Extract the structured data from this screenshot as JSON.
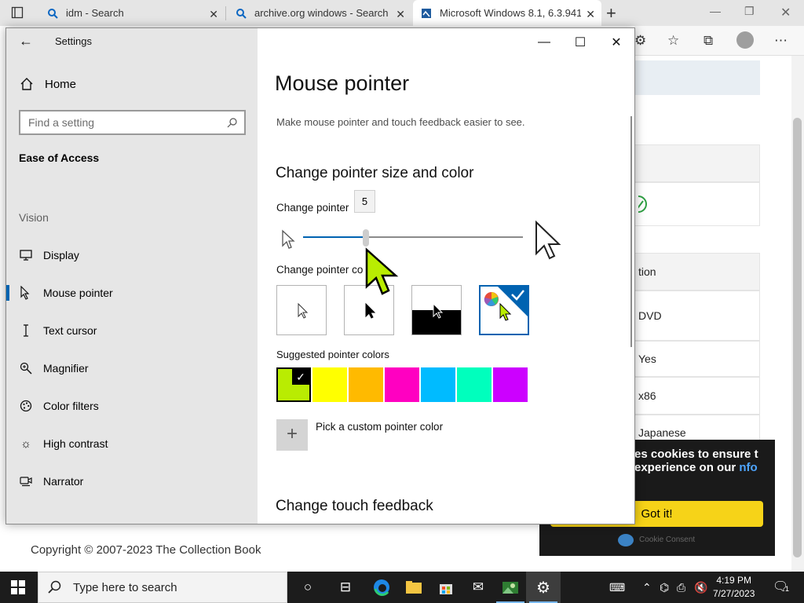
{
  "browser": {
    "tabs": [
      {
        "title": "idm - Search",
        "icon": "search-icon"
      },
      {
        "title": "archive.org windows - Search",
        "icon": "search-icon"
      },
      {
        "title": "Microsoft Windows 8.1, 6.3.9419",
        "icon": "page-icon"
      }
    ],
    "new_tab_glyph": "+"
  },
  "webpage": {
    "rows": [
      "tion",
      "DVD",
      "Yes",
      "x86",
      "Japanese"
    ],
    "copyright": "Copyright © 2007-2023 The Collection Book",
    "cookie": {
      "text": "es cookies to ensure t experience on our",
      "link": "nfo",
      "button": "Got it!",
      "brand": "Cookie Consent"
    }
  },
  "settings": {
    "app_title": "Settings",
    "home": "Home",
    "search_placeholder": "Find a setting",
    "section": "Ease of Access",
    "group": "Vision",
    "nav": [
      {
        "label": "Display",
        "icon": "display-icon"
      },
      {
        "label": "Mouse pointer",
        "icon": "mouse-pointer-icon",
        "selected": true
      },
      {
        "label": "Text cursor",
        "icon": "text-cursor-icon"
      },
      {
        "label": "Magnifier",
        "icon": "magnifier-icon"
      },
      {
        "label": "Color filters",
        "icon": "color-filters-icon"
      },
      {
        "label": "High contrast",
        "icon": "high-contrast-icon"
      },
      {
        "label": "Narrator",
        "icon": "narrator-icon"
      }
    ],
    "page_title": "Mouse pointer",
    "description": "Make mouse pointer and touch feedback easier to see.",
    "size_heading": "Change pointer size and color",
    "size_label": "Change pointer",
    "size_value": "5",
    "size_range": [
      1,
      15
    ],
    "color_label": "Change pointer co",
    "color_options": [
      "white",
      "black",
      "inverted",
      "custom"
    ],
    "selected_color_option": "custom",
    "suggested_label": "Suggested pointer colors",
    "suggested_colors": [
      "#b9ec02",
      "#ffff00",
      "#ffba00",
      "#ff00c1",
      "#00bbff",
      "#00ffbd",
      "#cc00ff"
    ],
    "selected_suggested": 0,
    "custom_button": "+",
    "custom_label": "Pick a custom pointer color",
    "touch_heading": "Change touch feedback",
    "accent_color": "#0063b1"
  },
  "taskbar": {
    "search_placeholder": "Type here to search",
    "time": "4:19 PM",
    "date": "7/27/2023",
    "notification_count": "1"
  }
}
